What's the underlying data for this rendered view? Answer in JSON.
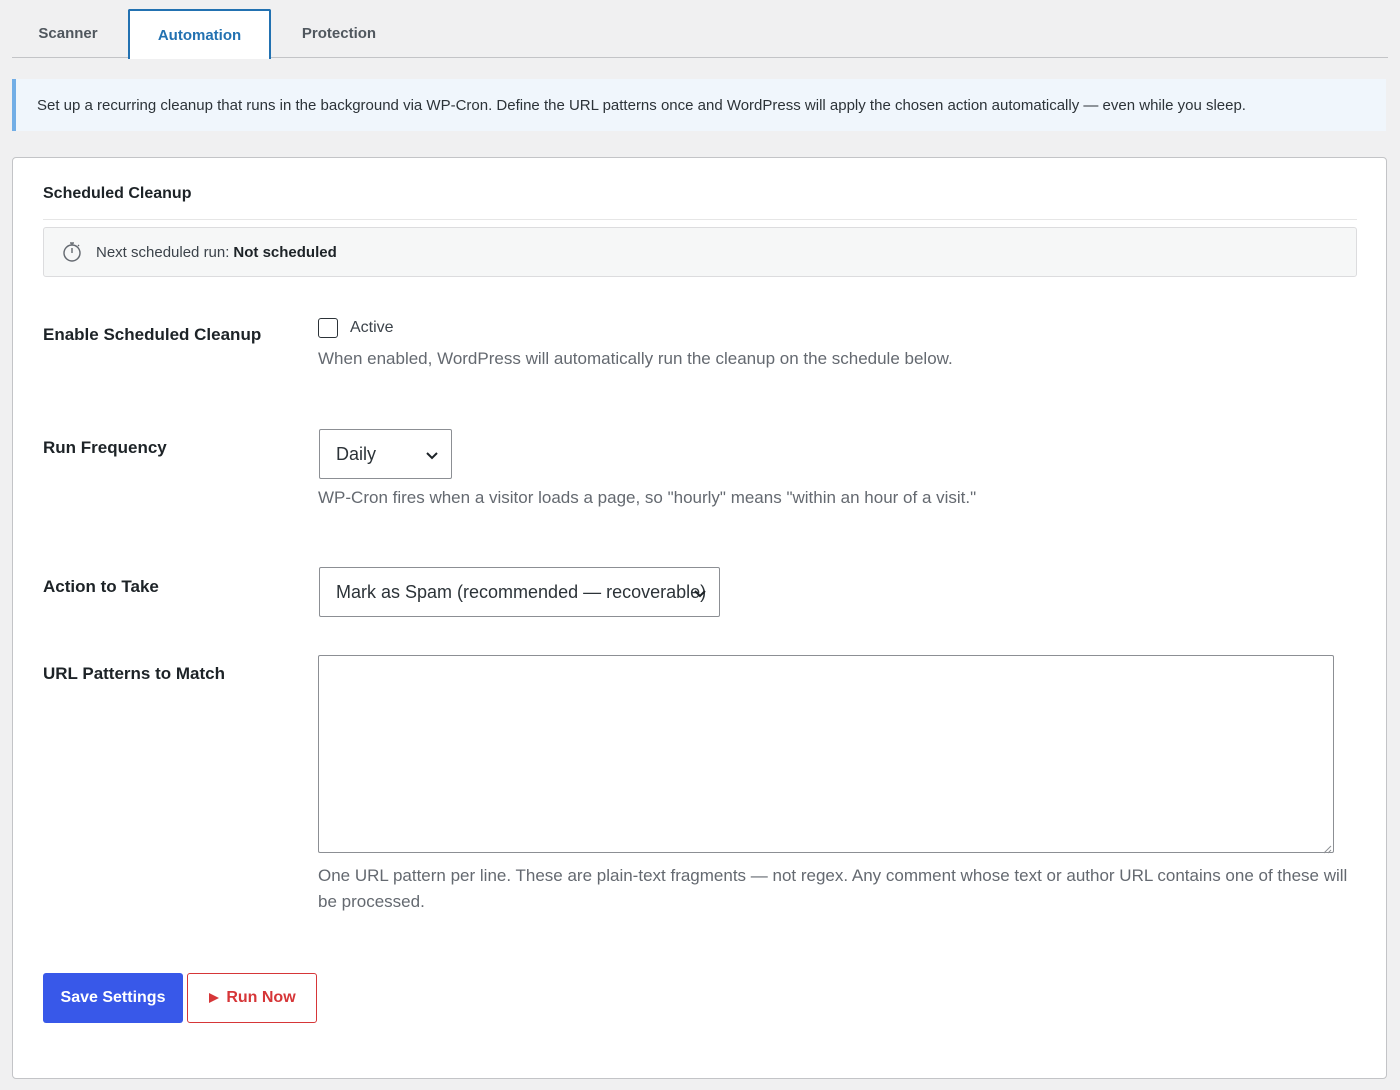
{
  "tabs": [
    {
      "label": "Scanner",
      "active": false
    },
    {
      "label": "Automation",
      "active": true
    },
    {
      "label": "Protection",
      "active": false
    }
  ],
  "notice": {
    "text": "Set up a recurring cleanup that runs in the background via WP-Cron. Define the URL patterns once and WordPress will apply the chosen action automatically — even while you sleep."
  },
  "card": {
    "title": "Scheduled Cleanup",
    "status": {
      "icon": "timer-icon",
      "label": "Next scheduled run:",
      "value": "Not scheduled"
    },
    "enable": {
      "label": "Enable Scheduled Cleanup",
      "checkbox_label": "Active",
      "checked": false,
      "description": "When enabled, WordPress will automatically run the cleanup on the schedule below."
    },
    "frequency": {
      "label": "Run Frequency",
      "selected": "Daily",
      "description": "WP-Cron fires when a visitor loads a page, so \"hourly\" means \"within an hour of a visit.\""
    },
    "action": {
      "label": "Action to Take",
      "selected": "Mark as Spam (recommended — recoverable)"
    },
    "patterns": {
      "label": "URL Patterns to Match",
      "value": "",
      "description": "One URL pattern per line. These are plain-text fragments — not regex. Any comment whose text or author URL contains one of these will be processed."
    },
    "buttons": {
      "save": "Save Settings",
      "run_now": "Run Now"
    }
  },
  "colors": {
    "accent": "#2271b1",
    "primary_button": "#3858e9",
    "danger": "#d63638",
    "notice_border": "#72aee6"
  }
}
